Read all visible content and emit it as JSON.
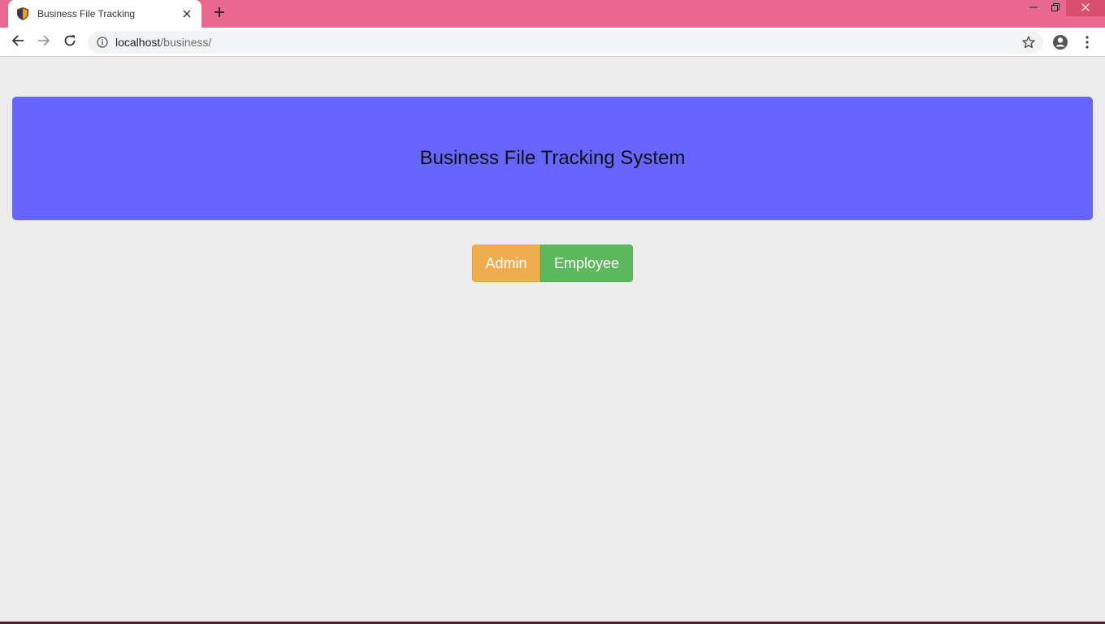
{
  "browser": {
    "tab_title": "Business File Tracking",
    "url_host": "localhost",
    "url_path": "/business/",
    "icons": {
      "favicon": "shield-icon",
      "tab_close": "close-icon",
      "new_tab": "plus-icon",
      "back": "arrow-left-icon",
      "forward": "arrow-right-icon",
      "reload": "reload-icon",
      "site_info": "info-icon",
      "bookmark": "star-icon",
      "profile": "account-icon",
      "menu": "kebab-menu-icon",
      "minimize": "minimize-icon",
      "maximize": "restore-icon",
      "close_window": "close-icon"
    },
    "colors": {
      "frame": "#e86890",
      "close": "#d84f6e"
    }
  },
  "page": {
    "banner_title": "Business File Tracking System",
    "buttons": {
      "admin": "Admin",
      "employee": "Employee"
    },
    "colors": {
      "background": "#ececec",
      "banner": "#6666ff",
      "admin": "#f0ad4e",
      "employee": "#5cb85c"
    }
  }
}
